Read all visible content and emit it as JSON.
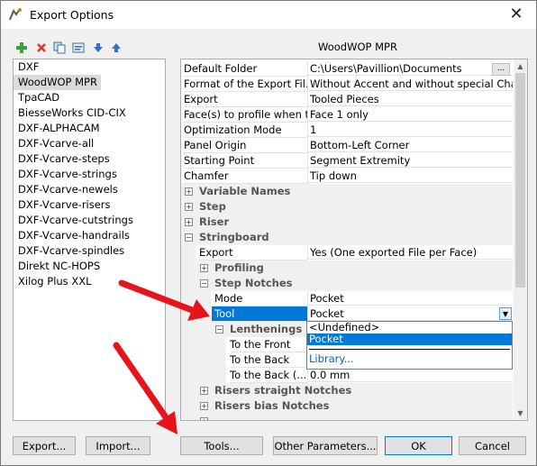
{
  "window": {
    "title": "Export Options"
  },
  "toolbar": {
    "icons": [
      "add-icon",
      "delete-icon",
      "copy-icon",
      "properties-icon",
      "move-down-icon",
      "move-up-icon"
    ]
  },
  "panel_title": "WoodWOP MPR",
  "formats": [
    "DXF",
    "WoodWOP MPR",
    "TpaCAD",
    "BiesseWorks CID-CIX",
    "DXF-ALPHACAM",
    "DXF-Vcarve-all",
    "DXF-Vcarve-steps",
    "DXF-Vcarve-strings",
    "DXF-Vcarve-newels",
    "DXF-Vcarve-risers",
    "DXF-Vcarve-cutstrings",
    "DXF-Vcarve-handrails",
    "DXF-Vcarve-spindles",
    "Direkt NC-HOPS",
    "Xilog Plus XXL"
  ],
  "selected_format": "WoodWOP MPR",
  "properties": [
    {
      "name": "Default Folder",
      "value": "C:\\Users\\Pavillion\\Documents",
      "button": "..."
    },
    {
      "name": "Format of the Export Fil...",
      "value": "Without Accent and without special Charac..."
    },
    {
      "name": "Export",
      "value": "Tooled Pieces"
    },
    {
      "name": "Face(s) to profile when t...",
      "value": "Face 1 only"
    },
    {
      "name": "Optimization Mode",
      "value": "1"
    },
    {
      "name": "Panel Origin",
      "value": "Bottom-Left Corner"
    },
    {
      "name": "Starting Point",
      "value": "Segment Extremity"
    },
    {
      "name": "Chamfer",
      "value": "Tip down"
    }
  ],
  "categories": {
    "variable_names": "Variable Names",
    "step": "Step",
    "riser": "Riser",
    "stringboard": "Stringboard",
    "stringboard_export": {
      "name": "Export",
      "value": "Yes (One exported File per Face)"
    },
    "profiling": "Profiling",
    "step_notches": "Step Notches",
    "mode": {
      "name": "Mode",
      "value": "Pocket"
    },
    "tool": {
      "name": "Tool",
      "value": "Pocket"
    },
    "lenthenings": "Lenthenings",
    "to_the_front": "To the Front",
    "to_the_back": "To the Back",
    "to_the_back_2": {
      "name": "To the Back (...",
      "value": "0.0 mm"
    },
    "risers_straight": "Risers straight Notches",
    "risers_bias": "Risers bias Notches"
  },
  "dropdown": {
    "items": [
      "<Undefined>",
      "Pocket"
    ],
    "selected": "Pocket",
    "link": "Library..."
  },
  "buttons": {
    "export": "Export...",
    "import": "Import...",
    "tools": "Tools...",
    "other": "Other Parameters...",
    "ok": "OK",
    "cancel": "Cancel"
  },
  "colors": {
    "selection": "#0078d7",
    "arrow": "#e8141c"
  }
}
